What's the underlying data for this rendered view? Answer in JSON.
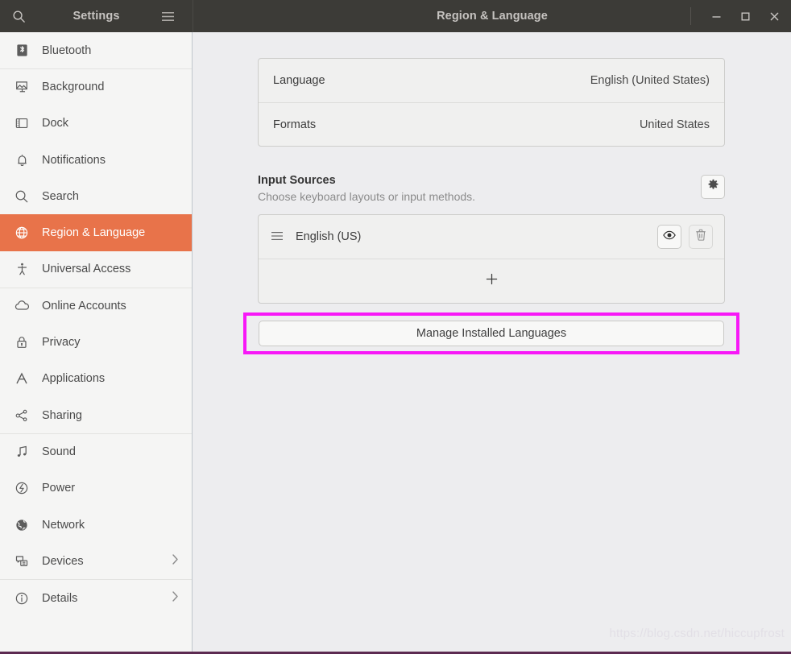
{
  "window": {
    "app_title": "Settings",
    "page_title": "Region & Language",
    "search_icon": "search-icon",
    "menu_icon": "hamburger-menu-icon",
    "minimize_label": "–",
    "maximize_label": "□",
    "close_label": "✕",
    "accent_color": "#e8734a",
    "highlight_color": "#f718f7"
  },
  "sidebar": {
    "items": [
      {
        "label": "Bluetooth",
        "icon": "bluetooth-icon",
        "selected": false,
        "chevron": false,
        "separator_above": false
      },
      {
        "label": "Background",
        "icon": "background-icon",
        "selected": false,
        "chevron": false,
        "separator_above": true
      },
      {
        "label": "Dock",
        "icon": "dock-icon",
        "selected": false,
        "chevron": false,
        "separator_above": false
      },
      {
        "label": "Notifications",
        "icon": "notifications-icon",
        "selected": false,
        "chevron": false,
        "separator_above": false
      },
      {
        "label": "Search",
        "icon": "search-icon",
        "selected": false,
        "chevron": false,
        "separator_above": false
      },
      {
        "label": "Region & Language",
        "icon": "globe-icon",
        "selected": true,
        "chevron": false,
        "separator_above": false
      },
      {
        "label": "Universal Access",
        "icon": "accessibility-icon",
        "selected": false,
        "chevron": false,
        "separator_above": false
      },
      {
        "label": "Online Accounts",
        "icon": "cloud-icon",
        "selected": false,
        "chevron": false,
        "separator_above": true
      },
      {
        "label": "Privacy",
        "icon": "lock-icon",
        "selected": false,
        "chevron": false,
        "separator_above": false
      },
      {
        "label": "Applications",
        "icon": "applications-icon",
        "selected": false,
        "chevron": false,
        "separator_above": false
      },
      {
        "label": "Sharing",
        "icon": "share-icon",
        "selected": false,
        "chevron": false,
        "separator_above": false
      },
      {
        "label": "Sound",
        "icon": "sound-icon",
        "selected": false,
        "chevron": false,
        "separator_above": true
      },
      {
        "label": "Power",
        "icon": "power-icon",
        "selected": false,
        "chevron": false,
        "separator_above": false
      },
      {
        "label": "Network",
        "icon": "network-icon",
        "selected": false,
        "chevron": false,
        "separator_above": false
      },
      {
        "label": "Devices",
        "icon": "devices-icon",
        "selected": false,
        "chevron": true,
        "separator_above": false
      },
      {
        "label": "Details",
        "icon": "info-icon",
        "selected": false,
        "chevron": true,
        "separator_above": true
      }
    ]
  },
  "main": {
    "locale_rows": [
      {
        "label": "Language",
        "value": "English (United States)"
      },
      {
        "label": "Formats",
        "value": "United States"
      }
    ],
    "input_sources": {
      "title": "Input Sources",
      "subtitle": "Choose keyboard layouts or input methods.",
      "settings_icon": "gear-icon",
      "sources": [
        {
          "name": "English (US)",
          "handle_icon": "drag-handle-icon",
          "preview_icon": "eye-icon",
          "remove_icon": "trash-icon"
        }
      ],
      "add_icon": "plus-icon",
      "add_label": "+"
    },
    "manage_button_label": "Manage Installed Languages"
  },
  "watermark": {
    "text": "https://blog.csdn.net/hiccupfrost"
  }
}
